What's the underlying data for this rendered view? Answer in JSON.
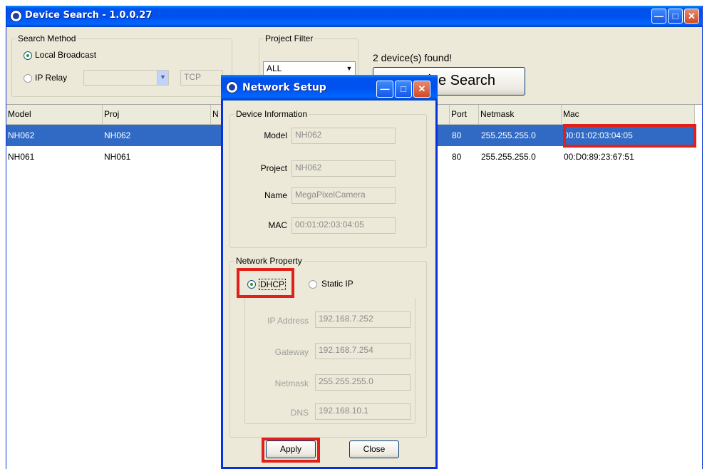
{
  "main_window": {
    "title": "Device Search - 1.0.0.27",
    "search_method": {
      "legend": "Search Method",
      "local_broadcast": "Local Broadcast",
      "ip_relay": "IP Relay",
      "ip_relay_value": "",
      "protocol": "TCP"
    },
    "project_filter": {
      "legend": "Project Filter",
      "selected": "ALL"
    },
    "status": "2 device(s) found!",
    "search_button": "Device Search",
    "table": {
      "columns": [
        "Model",
        "Proj",
        "N",
        "Port",
        "Netmask",
        "Mac"
      ],
      "rows": [
        {
          "model": "NH062",
          "proj": "NH062",
          "port": "80",
          "netmask": "255.255.255.0",
          "mac": "00:01:02:03:04:05",
          "selected": true
        },
        {
          "model": "NH061",
          "proj": "NH061",
          "port": "80",
          "netmask": "255.255.255.0",
          "mac": "00:D0:89:23:67:51",
          "selected": false
        }
      ]
    }
  },
  "dialog": {
    "title": "Network Setup",
    "device_info": {
      "legend": "Device Information",
      "model_label": "Model",
      "model_value": "NH062",
      "project_label": "Project",
      "project_value": "NH062",
      "name_label": "Name",
      "name_value": "MegaPixelCamera",
      "mac_label": "MAC",
      "mac_value": "00:01:02:03:04:05"
    },
    "network_property": {
      "legend": "Network Property",
      "dhcp_label": "DHCP",
      "static_label": "Static IP",
      "mode": "DHCP",
      "ip_label": "IP Address",
      "ip_value": "192.168.7.252",
      "gateway_label": "Gateway",
      "gateway_value": "192.168.7.254",
      "netmask_label": "Netmask",
      "netmask_value": "255.255.255.0",
      "dns_label": "DNS",
      "dns_value": "192.168.10.1"
    },
    "apply_button": "Apply",
    "close_button": "Close"
  },
  "colors": {
    "titlebar": "#0054e3",
    "selection": "#316ac5",
    "highlight_box": "#e0201b",
    "window_bg": "#ece9d8"
  },
  "icons": {
    "app": "app-logo-icon",
    "minimize": "minimize-icon",
    "maximize": "maximize-icon",
    "close": "close-icon",
    "dropdown": "chevron-down-icon"
  }
}
